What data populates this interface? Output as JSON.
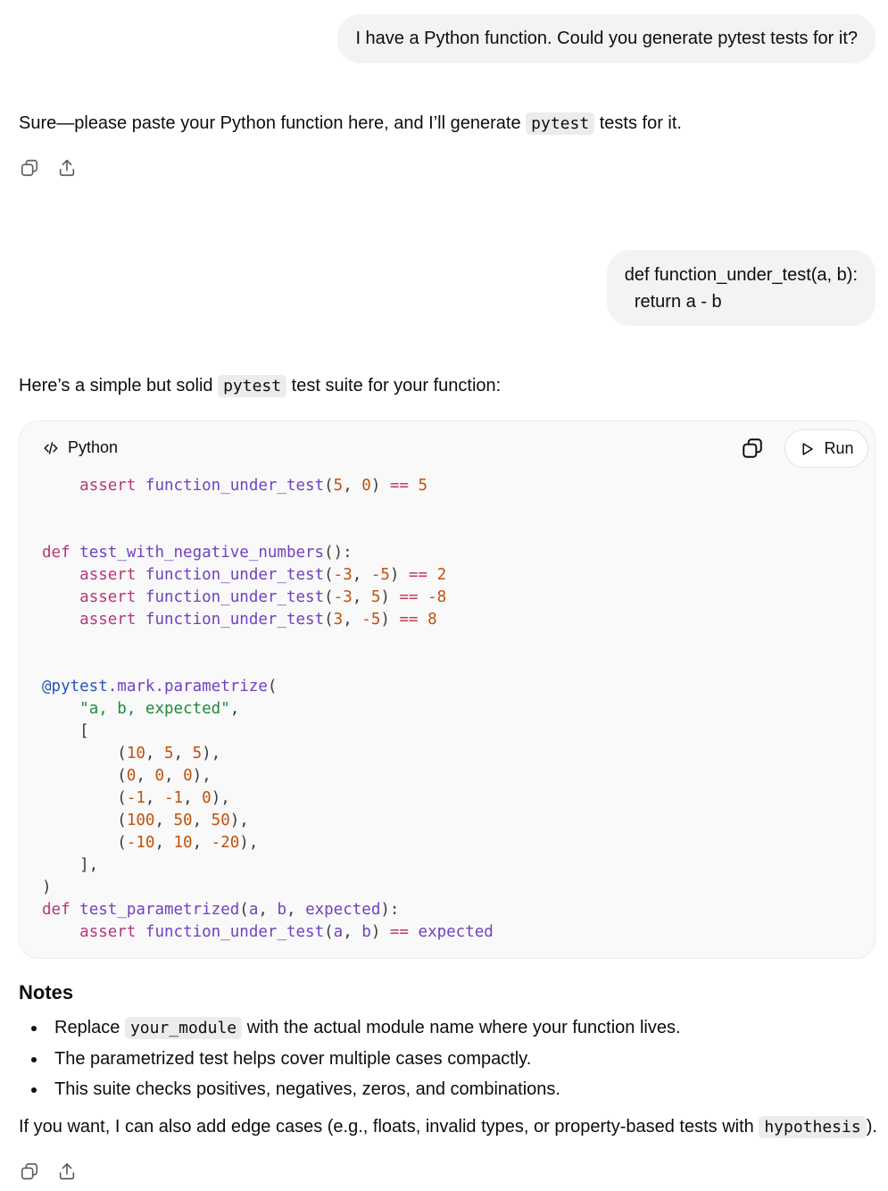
{
  "messages": {
    "user1": "I have a Python function. Could you generate pytest tests for it?",
    "reply1": {
      "before": "Sure—please paste your Python function here, and I’ll generate ",
      "code": "pytest",
      "after": " tests for it."
    },
    "user2": {
      "line1": "def function_under_test(a, b):",
      "line2": "  return a - b"
    },
    "reply2": {
      "intro_before": "Here’s a simple but solid ",
      "intro_code": "pytest",
      "intro_after": " test suite for your function:"
    }
  },
  "code_block": {
    "language": "Python",
    "run_label": "Run"
  },
  "notes": {
    "heading": "Notes",
    "item1_before": "Replace ",
    "item1_code": "your_module",
    "item1_after": " with the actual module name where your function lives.",
    "item2": "The parametrized test helps cover multiple cases compactly.",
    "item3": "This suite checks positives, negatives, zeros, and combinations."
  },
  "closing": {
    "before": "If you want, I can also add edge cases (e.g., floats, invalid types, or property-based tests with ",
    "code": "hypothesis",
    "after": ")."
  },
  "icons": {
    "copy": "copy-icon",
    "share": "share-icon",
    "code": "code-icon",
    "play": "play-icon"
  }
}
